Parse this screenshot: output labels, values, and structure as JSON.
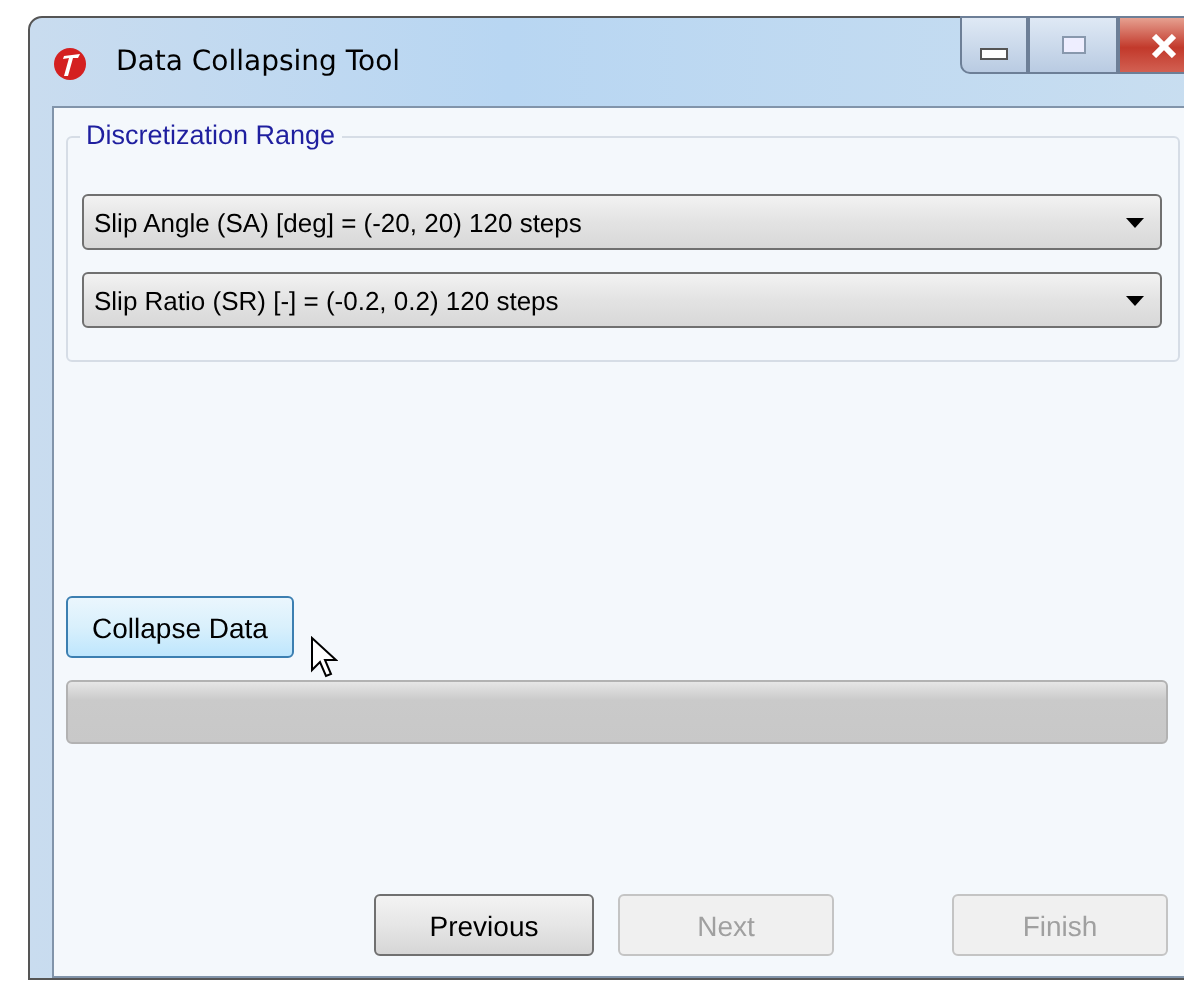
{
  "window": {
    "title": "Data Collapsing Tool"
  },
  "group": {
    "title": "Discretization Range",
    "combos": [
      {
        "value": "Slip Angle (SA) [deg] = (-20, 20) 120 steps"
      },
      {
        "value": "Slip Ratio (SR) [-] = (-0.2, 0.2) 120 steps"
      }
    ]
  },
  "collapse_button": {
    "label": "Collapse Data",
    "hovered": true
  },
  "progress": {
    "level": 0
  },
  "buttons": [
    {
      "label": "Previous",
      "disabled": false
    },
    {
      "label": "Next",
      "disabled": true
    },
    {
      "label": "Finish",
      "disabled": true
    }
  ]
}
